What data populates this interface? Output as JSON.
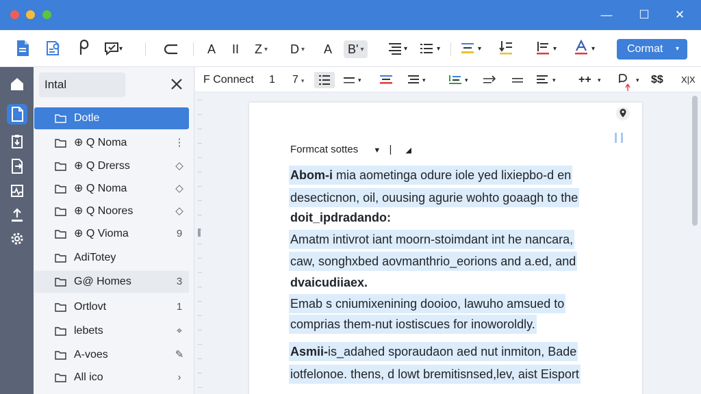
{
  "window": {
    "minimize_glyph": "—",
    "maximize_glyph": "☐",
    "close_glyph": "✕"
  },
  "ribbon": {
    "buttons": [
      {
        "label": "A"
      },
      {
        "label": "II"
      },
      {
        "label": "Z"
      },
      {
        "label": "D"
      },
      {
        "label": "A"
      },
      {
        "label": "B'"
      }
    ],
    "cormat_label": "Cormat"
  },
  "sidebar": {
    "search_value": "Intal",
    "items": [
      {
        "label": "Dotle",
        "badge": ""
      },
      {
        "label": "⊕ Q Noma",
        "badge": "⋮"
      },
      {
        "label": "⊕ Q Drerss",
        "badge": "◇"
      },
      {
        "label": "⊕ Q Noma",
        "badge": "◇"
      },
      {
        "label": "⊕ Q Noores",
        "badge": "◇"
      },
      {
        "label": "⊕ Q Vioma",
        "badge": "9"
      },
      {
        "label": "AdiTotey",
        "badge": ""
      },
      {
        "label": "G@ Homes",
        "badge": "3"
      },
      {
        "label": "Ortlovt",
        "badge": "1"
      },
      {
        "label": "lebets",
        "badge": "⌖"
      },
      {
        "label": "A-voes",
        "badge": "✎"
      },
      {
        "label": "All ico",
        "badge": "›"
      }
    ]
  },
  "format_bar": {
    "font_label": "F Connect",
    "size_1": "1",
    "size_7": "7",
    "glyph_plus": "++",
    "glyph_dollar": "$$",
    "glyph_x": "X|X"
  },
  "document": {
    "style_label": "Formcat sottes",
    "lines": [
      {
        "text": "Abom-i mia aometinga odure iole yed lixiepbo-d en"
      },
      {
        "text": "desecticnon, oil, ouusing agurie wohto goaagh to the"
      },
      {
        "text": "doit_ipdradando:"
      },
      {
        "text": "Amatm intivrot iant moorn-stoimdant int he nancara,"
      },
      {
        "text": "caw, songhxbed aovmanthrio_eorions and a.ed, and"
      },
      {
        "text": "dvaicudiiaex."
      },
      {
        "text": "Emab s cniumixenining dooioo, lawuho amsued to"
      },
      {
        "text": "comprias them-nut iostiscues for inoworoldly."
      },
      {
        "text": "Asmii-is_adahed sporaudaon aed nut inmiton, Bade"
      },
      {
        "text": "iotfelonoe. thens, d lowt bremitisnsed,lev, aist Eisport"
      }
    ]
  },
  "colors": {
    "accent": "#3d7fd9",
    "rail": "#5a6476",
    "highlight": "#dcecfb"
  }
}
